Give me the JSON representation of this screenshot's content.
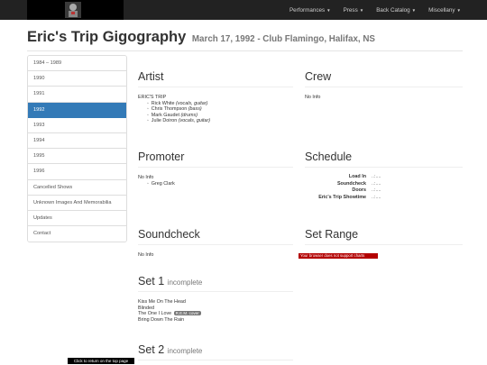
{
  "nav": {
    "items": [
      {
        "label": "Performances"
      },
      {
        "label": "Press"
      },
      {
        "label": "Back Catalog"
      },
      {
        "label": "Miscellany"
      }
    ]
  },
  "header": {
    "title": "Eric's Trip Gigography",
    "subtitle": "March 17, 1992 - Club Flamingo, Halifax, NS"
  },
  "sidebar": {
    "items": [
      {
        "label": "1984 – 1989"
      },
      {
        "label": "1990"
      },
      {
        "label": "1991"
      },
      {
        "label": "1992",
        "active": true
      },
      {
        "label": "1993"
      },
      {
        "label": "1994"
      },
      {
        "label": "1995"
      },
      {
        "label": "1996"
      },
      {
        "label": "Cancelled Shows"
      },
      {
        "label": "Unknown Images And Memorabilia"
      },
      {
        "label": "Updates"
      },
      {
        "label": "Contact"
      }
    ]
  },
  "artist": {
    "heading": "Artist",
    "band": "ERIC'S TRIP",
    "members": [
      {
        "name": "Rick White",
        "role": "(vocals, guitar)"
      },
      {
        "name": "Chris Thompson",
        "role": "(bass)"
      },
      {
        "name": "Mark Gaudet",
        "role": "(drums)"
      },
      {
        "name": "Julie Doiron",
        "role": "(vocals, guitar)"
      }
    ]
  },
  "crew": {
    "heading": "Crew",
    "text": "No Info"
  },
  "promoter": {
    "heading": "Promoter",
    "text": "No Info",
    "names": [
      "Greg Clark"
    ]
  },
  "schedule": {
    "heading": "Schedule",
    "rows": [
      {
        "label": "Load In",
        "value": "..:...."
      },
      {
        "label": "Soundcheck",
        "value": "..:...."
      },
      {
        "label": "Doors",
        "value": "..:...."
      },
      {
        "label": "Eric's Trip Showtime",
        "value": "..:...."
      }
    ]
  },
  "soundcheck": {
    "heading": "Soundcheck",
    "text": "No Info"
  },
  "set_range": {
    "heading": "Set Range",
    "chart_error": "Your browser does not support charts"
  },
  "set1": {
    "heading": "Set 1",
    "status": "incomplete",
    "songs": [
      "Kiss Me On The Head",
      "Blinded",
      "The One I Love",
      "Bring Down The Rain"
    ],
    "cover_badge": "R.E.M. cover"
  },
  "set2": {
    "heading": "Set 2",
    "status": "incomplete"
  },
  "back_to_top": "Click to return on the top page"
}
